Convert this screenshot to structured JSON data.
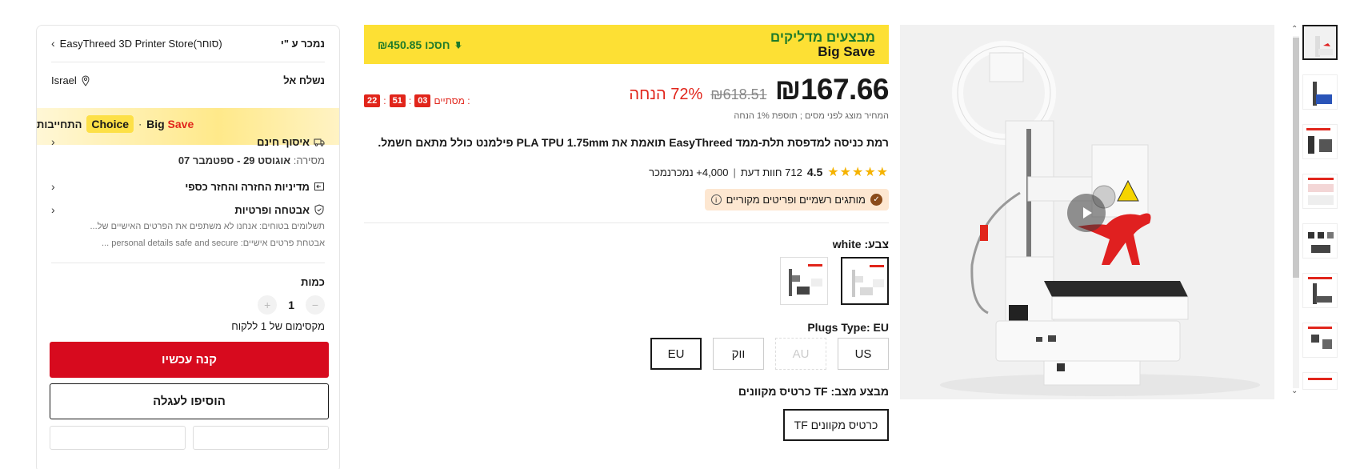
{
  "seller": {
    "sold_by_label": "נמכר ע \"י",
    "store_name": "EasyThreed 3D Printer Store(סוחר)"
  },
  "shipping": {
    "ship_to_label": "נשלח אל",
    "country": "Israel"
  },
  "commitment": {
    "label": "התחייבות",
    "choice": "Choice",
    "big": "Big",
    "save": "Save"
  },
  "pickup": {
    "title": "איסוף חינם",
    "delivery_prefix": "מסירה:",
    "delivery_dates": "אוגוסט 29 - ספטמבר 07"
  },
  "returns": {
    "title": "מדיניות החזרה והחזר כספי"
  },
  "security": {
    "title": "אבטחה ופרטיות",
    "line1": "תשלומים בטוחים: אנחנו לא משתפים את הפרטים האישיים של...",
    "line2": "אבטחת פרטים אישיים: personal details safe and secure ..."
  },
  "quantity": {
    "label": "כמות",
    "value": "1",
    "minus": "−",
    "plus": "+",
    "max_note": "מקסימום של 1 ללקוח"
  },
  "actions": {
    "buy_now": "קנה עכשיו",
    "add_to_cart": "הוסיפו לעגלה"
  },
  "banner": {
    "price": "₪450.85 חסכו",
    "title_he": "מבצעים מדליקים",
    "title_en": "Big Save"
  },
  "timer": {
    "label": "מסתיים :",
    "h": "03",
    "m": "51",
    "s": "22"
  },
  "pricing": {
    "current": "₪167.66",
    "original": "₪618.51",
    "discount": "72% הנחה",
    "tax_note": "המחיר מוצג לפני מסים ; תוספת 1% הנחה"
  },
  "product": {
    "title": "רמת כניסה למדפסת תלת-ממד EasyThreed תואמת את PLA TPU 1.75mm פילמנט כולל מתאם חשמל."
  },
  "rating": {
    "stars": "★★★★★",
    "score": "4.5",
    "reviews": "712 חוות דעת",
    "sold": "4,000+ נמכרנמכר",
    "sep": "|"
  },
  "verified": {
    "text": "מותגים רשמיים ופריטים מקוריים",
    "check": "✓",
    "info": "i"
  },
  "color": {
    "label": "צבע: white"
  },
  "plugs": {
    "label": "Plugs Type: EU",
    "options": [
      "US",
      "AU",
      "ווק",
      "EU"
    ]
  },
  "bundle": {
    "label": "מבצע מצב: TF כרטיס מקוונים",
    "option": "TF כרטיס מקוונים"
  },
  "colors": {
    "brand_red": "#d70a1e",
    "banner_yellow": "#fde034",
    "deal_green": "#1e7a2a"
  }
}
